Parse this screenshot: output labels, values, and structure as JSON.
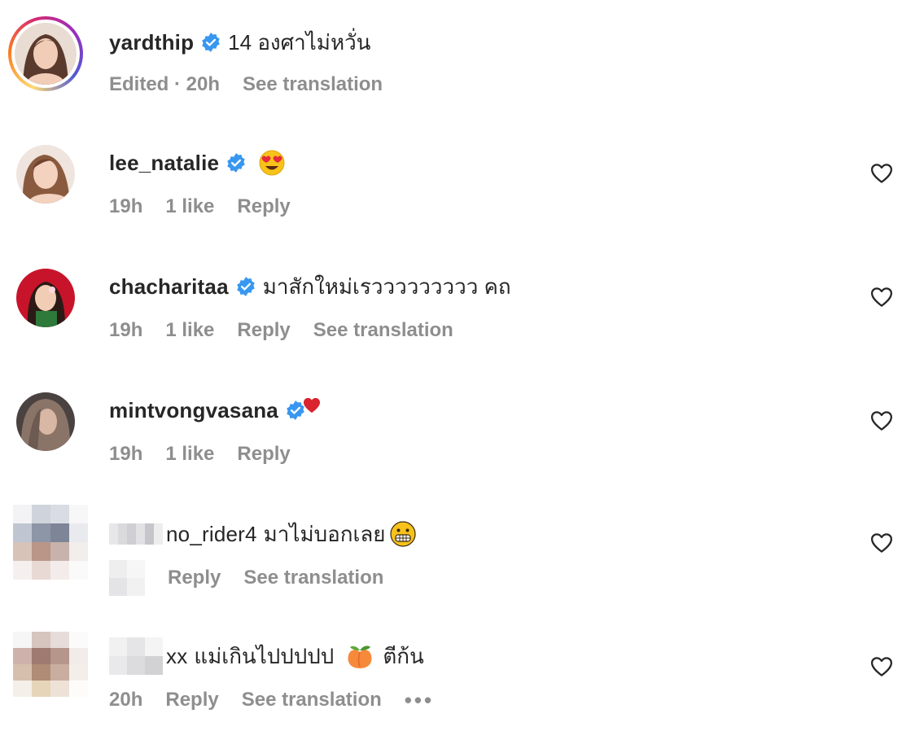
{
  "comments": [
    {
      "username": "yardthip",
      "text": "14 องศาไม่หวั่น",
      "edited": "Edited · 20h",
      "see_translation": "See translation"
    },
    {
      "username": "lee_natalie",
      "time": "19h",
      "likes": "1 like",
      "reply": "Reply"
    },
    {
      "username": "chacharitaa",
      "text": "มาสักใหม่เรววววววววว คถ",
      "time": "19h",
      "likes": "1 like",
      "reply": "Reply",
      "see_translation": "See translation"
    },
    {
      "username": "mintvongvasana",
      "time": "19h",
      "likes": "1 like",
      "reply": "Reply"
    },
    {
      "username_visible": "no_rider4",
      "text": "มาไม่บอกเลย",
      "reply": "Reply",
      "see_translation": "See translation"
    },
    {
      "username_visible": "xx",
      "text": "แม่เกินไปปปปป",
      "text_after": "ตีก้น",
      "time": "20h",
      "reply": "Reply",
      "see_translation": "See translation",
      "more": "•••"
    }
  ],
  "icons": {
    "verified": "verified-badge-icon",
    "heart": "heart-outline-icon",
    "emoji_heart_eyes": "heart-eyes-emoji",
    "emoji_red_heart": "red-heart-emoji",
    "emoji_grin": "grimacing-emoji",
    "emoji_peach": "peach-emoji"
  },
  "colors": {
    "verified_blue": "#3897f0",
    "muted_text": "#8e8e8e",
    "primary_text": "#262626"
  }
}
